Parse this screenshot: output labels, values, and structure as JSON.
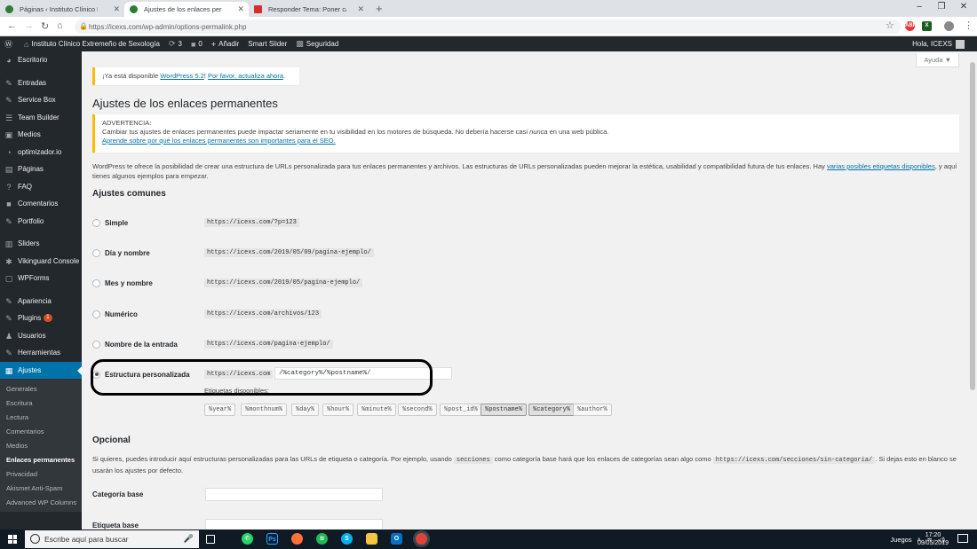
{
  "browser": {
    "tabs": [
      {
        "title": "Páginas ‹ Instituto Clínico Extrem",
        "active": false,
        "color": "#2f7d32"
      },
      {
        "title": "Ajustes de los enlaces permanen",
        "active": true,
        "color": "#2f7d32"
      },
      {
        "title": "Responder Tema: Poner categoría",
        "active": false,
        "color": "#d32f2f"
      }
    ],
    "url": "https://icexs.com/wp-admin/options-permalink.php"
  },
  "adminbar": {
    "site_name": "Instituto Clínico Extremeño de Sexología",
    "updates": "3",
    "comments": "0",
    "add_new": "Añadir",
    "smart_slider": "Smart Slider",
    "security": "Seguridad",
    "howdy": "Hola, ICEXS"
  },
  "sidebar": {
    "items": [
      {
        "label": "Escritorio",
        "icon": "dashboard-icon",
        "glyph": "◕"
      },
      {
        "label": "Entradas",
        "icon": "pushpin-icon",
        "glyph": "✎"
      },
      {
        "label": "Service Box",
        "icon": "wrench-icon",
        "glyph": "✎"
      },
      {
        "label": "Team Builder",
        "icon": "team-icon",
        "glyph": "☰"
      },
      {
        "label": "Medios",
        "icon": "media-icon",
        "glyph": "▣"
      },
      {
        "label": "optimizador.io",
        "icon": "gauge-icon",
        "glyph": "◔"
      },
      {
        "label": "Páginas",
        "icon": "pages-icon",
        "glyph": "▤"
      },
      {
        "label": "FAQ",
        "icon": "question-icon",
        "glyph": "?"
      },
      {
        "label": "Comentarios",
        "icon": "comment-icon",
        "glyph": "■"
      },
      {
        "label": "Portfolio",
        "icon": "portfolio-icon",
        "glyph": "✎"
      },
      {
        "label": "Sliders",
        "icon": "slider-icon",
        "glyph": "▥"
      },
      {
        "label": "Vikinguard Console",
        "icon": "gear-icon",
        "glyph": "✱"
      },
      {
        "label": "WPForms",
        "icon": "form-icon",
        "glyph": "▢"
      },
      {
        "label": "Apariencia",
        "icon": "brush-icon",
        "glyph": "✎"
      },
      {
        "label": "Plugins",
        "icon": "plugin-icon",
        "glyph": "✎",
        "badge": "1"
      },
      {
        "label": "Usuarios",
        "icon": "user-icon",
        "glyph": "♟"
      },
      {
        "label": "Herramientas",
        "icon": "tools-icon",
        "glyph": "✎"
      },
      {
        "label": "Ajustes",
        "icon": "settings-icon",
        "glyph": "▦"
      }
    ],
    "submenu": [
      "Generales",
      "Escritura",
      "Lectura",
      "Comentarios",
      "Medios",
      "Enlaces permanentes",
      "Privacidad",
      "Akismet Anti-Spam",
      "Advanced WP Columns"
    ]
  },
  "help": "Ayuda ▼",
  "update_notice": {
    "prefix": "¡Ya está disponible ",
    "link1": "WordPress 5.2",
    "middle": "! ",
    "link2": "Por favor, actualiza ahora",
    "suffix": "."
  },
  "page_title": "Ajustes de los enlaces permanentes",
  "warning": {
    "heading": "ADVERTENCIA:",
    "text1": "Cambiar tus ajustes de enlaces permanentes puede impactar seriamente en tu visibilidad en los motores de búsqueda. No debería hacerse casi ",
    "text_em": "nunca",
    "text2": " en una web pública.",
    "link": "Aprende sobre por qué los enlaces permanentes son importantes para el SEO."
  },
  "intro": {
    "text1": "WordPress te ofrece la posibilidad de crear una estructura de URLs personalizada para tus enlaces permanentes y archivos. Las estructuras de URLs personalizadas pueden mejorar la estética, usabilidad y compatibilidad futura de tus enlaces. Hay ",
    "link": "varias posibles etiquetas disponibles",
    "text2": ", y aquí tienes algunos ejemplos para empezar."
  },
  "common_heading": "Ajustes comunes",
  "options": [
    {
      "label": "Simple",
      "example": "https://icexs.com/?p=123"
    },
    {
      "label": "Día y nombre",
      "example": "https://icexs.com/2019/05/09/pagina-ejemplo/"
    },
    {
      "label": "Mes y nombre",
      "example": "https://icexs.com/2019/05/pagina-ejemplo/"
    },
    {
      "label": "Numérico",
      "example": "https://icexs.com/archivos/123"
    },
    {
      "label": "Nombre de la entrada",
      "example": "https://icexs.com/pagina-ejemplo/"
    }
  ],
  "custom": {
    "label": "Estructura personalizada",
    "prefix": "https://icexs.com",
    "value": "/%category%/%postname%/",
    "tags_label": "Etiquetas disponibles:",
    "tags": [
      "%year%",
      "%monthnum%",
      "%day%",
      "%hour%",
      "%minute%",
      "%second%",
      "%post_id%",
      "%postname%",
      "%category%",
      "%author%"
    ],
    "active_tags": [
      "%postname%",
      "%category%"
    ]
  },
  "optional": {
    "heading": "Opcional",
    "text1": "Si quieres, puedes introducir aquí estructuras personalizadas para las URLs de etiqueta o categoría. Por ejemplo, usando ",
    "code1": "secciones",
    "text2": " como categoría base hará que los enlaces de categorías sean algo como ",
    "code2": "https://icexs.com/secciones/sin-categoria/",
    "text3": ". Si dejas esto en blanco se usarán los ajustes por defecto.",
    "category_base": "Categoría base",
    "tag_base": "Etiqueta base"
  },
  "taskbar": {
    "search_placeholder": "Escribe aquí para buscar",
    "tray_label": "Juegos",
    "time": "17:20",
    "date": "09/05/2019"
  }
}
